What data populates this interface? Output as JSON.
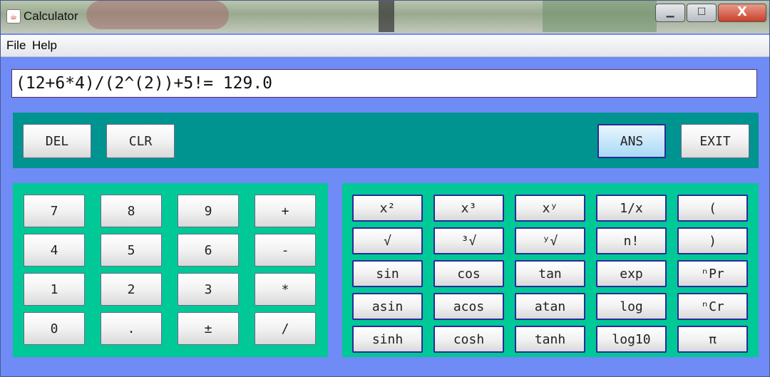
{
  "window": {
    "title": "Calculator",
    "minimize": "▁",
    "maximize": "☐",
    "close": "X"
  },
  "menu": {
    "items": [
      "File",
      "Help"
    ]
  },
  "display": {
    "expression": "(12+6*4)/(2^(2))+5!= 129.0"
  },
  "controls": {
    "del": "DEL",
    "clr": "CLR",
    "ans": "ANS",
    "exit": "EXIT"
  },
  "keypad": {
    "rows": [
      [
        "7",
        "8",
        "9",
        "+"
      ],
      [
        "4",
        "5",
        "6",
        "-"
      ],
      [
        "1",
        "2",
        "3",
        "*"
      ],
      [
        "0",
        ".",
        "±",
        "/"
      ]
    ]
  },
  "functions": {
    "rows": [
      [
        "x²",
        "x³",
        "xʸ",
        "1/x",
        "("
      ],
      [
        "√",
        "³√",
        "ʸ√",
        "n!",
        ")"
      ],
      [
        "sin",
        "cos",
        "tan",
        "exp",
        "ⁿPr"
      ],
      [
        "asin",
        "acos",
        "atan",
        "log",
        "ⁿCr"
      ],
      [
        "sinh",
        "cosh",
        "tanh",
        "log10",
        "π"
      ]
    ]
  },
  "colors": {
    "window_bg": "#6f8bf5",
    "top_panel": "#009490",
    "button_panels": "#00c896",
    "ans_highlight": "#c9e7fa"
  }
}
